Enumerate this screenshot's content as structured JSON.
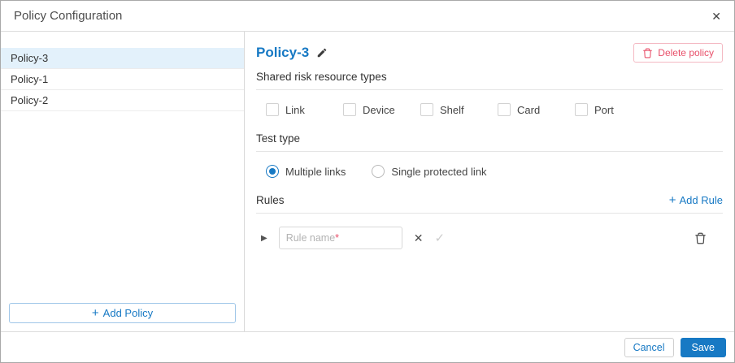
{
  "colors": {
    "accent_blue": "#1779c4",
    "danger_red": "#e8506a",
    "selected_bg": "#e3f1fb"
  },
  "dialog": {
    "title": "Policy Configuration",
    "close_icon": "✕"
  },
  "sidebar": {
    "items": [
      {
        "label": "Policy-3",
        "selected": true
      },
      {
        "label": "Policy-1",
        "selected": false
      },
      {
        "label": "Policy-2",
        "selected": false
      }
    ],
    "add_policy": {
      "icon": "+",
      "label": "Add Policy"
    }
  },
  "main": {
    "policy_title": "Policy-3",
    "delete_policy_label": "Delete policy",
    "shared_risk": {
      "title": "Shared risk resource types",
      "options": [
        "Link",
        "Device",
        "Shelf",
        "Card",
        "Port"
      ],
      "checked": [
        false,
        false,
        false,
        false,
        false
      ]
    },
    "test_type": {
      "title": "Test type",
      "options": [
        {
          "label": "Multiple links",
          "selected": true
        },
        {
          "label": "Single protected link",
          "selected": false
        }
      ]
    },
    "rules": {
      "title": "Rules",
      "add_rule": {
        "icon": "+",
        "label": "Add Rule"
      },
      "rule_input": {
        "value": "",
        "placeholder": "Rule name",
        "required_mark": "*"
      },
      "expander_icon": "▶",
      "cancel_icon": "✕",
      "confirm_icon": "✓"
    }
  },
  "footer": {
    "cancel_label": "Cancel",
    "save_label": "Save"
  }
}
